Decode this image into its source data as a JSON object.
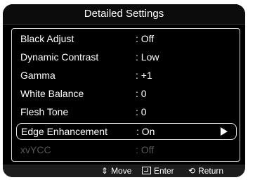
{
  "header": {
    "title": "Detailed Settings"
  },
  "menu": {
    "items": [
      {
        "label": "Black Adjust",
        "value": ": Off"
      },
      {
        "label": "Dynamic Contrast",
        "value": ": Low"
      },
      {
        "label": "Gamma",
        "value": ": +1"
      },
      {
        "label": "White Balance",
        "value": ": 0"
      },
      {
        "label": "Flesh Tone",
        "value": ": 0"
      },
      {
        "label": "Edge Enhancement",
        "value": ": On",
        "selected": true
      },
      {
        "label": "xvYCC",
        "value": ": Off",
        "disabled": true
      }
    ]
  },
  "footer": {
    "move_icon": "⇕",
    "move_label": "Move",
    "enter_label": "Enter",
    "return_icon": "⟲",
    "return_label": "Return"
  },
  "colors": {
    "background": "#000000",
    "text": "#ffffff",
    "disabled_text": "#585858",
    "footer_bg": "#1c1c1c"
  },
  "icons": {
    "selected_arrow": "right-triangle-icon",
    "move": "up-down-arrows-icon",
    "enter": "enter-icon",
    "return": "return-icon"
  }
}
